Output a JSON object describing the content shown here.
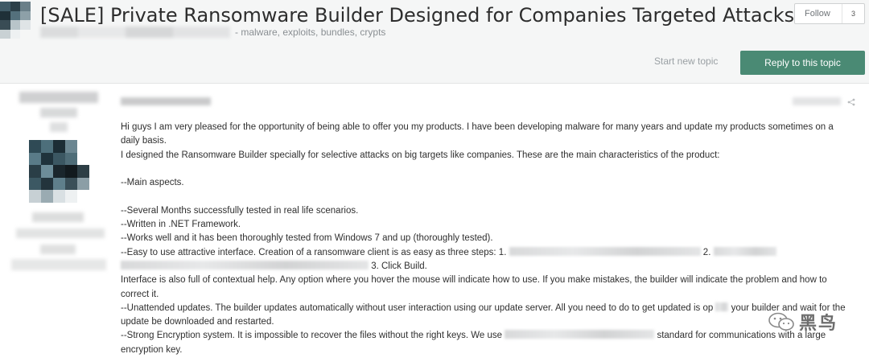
{
  "header": {
    "title": "[SALE] Private Ransomware Builder Designed for Companies Targeted Attacks",
    "forum_tags": "- malware, exploits, bundles, crypts",
    "follow_label": "Follow",
    "follow_count": "3",
    "start_topic_label": "Start new topic",
    "reply_label": "Reply to this topic"
  },
  "post": {
    "intro_1": "Hi guys I am very pleased for the opportunity of being able to offer you my products. I have been developing malware for many years and update my products sometimes on a daily basis.",
    "intro_2": "I designed the Ransomware Builder specially for selective attacks on big targets like companies. These are the main characteristics of the product:",
    "main_aspects": "--Main aspects.",
    "tested": "--Several Months successfully tested in real life scenarios.",
    "written": "--Written in .NET Framework.",
    "works": "--Works well and it has been thoroughly tested from Windows 7 and up (thoroughly tested).",
    "easy_start": "--Easy to use attractive interface. Creation of a ransomware client is as easy as three steps: 1.",
    "step_2": "2.",
    "step_3": "3. Click Build.",
    "help": "Interface is also full of contextual help. Any option where you hover the mouse will indicate how to use. If you make mistakes, the builder will indicate the problem and how to correct it.",
    "updates_start": "--Unattended updates. The builder updates automatically without user interaction using our update server. All you need to do to get updated is op",
    "updates_end": "your builder and wait for the update be downloaded and restarted.",
    "encryption_start": "--Strong Encryption system. It is impossible to recover the files without the right keys. We use",
    "encryption_end": "standard for communications with a large encryption key."
  },
  "watermark": {
    "text": "黑鸟"
  },
  "colors": {
    "accent_green": "#4a8a74",
    "header_bg": "#f5f6f6",
    "text": "#2f2f2f",
    "muted": "#9aa0a4"
  },
  "icons": {
    "share": "share-icon",
    "watermark": "wechat-icon"
  }
}
